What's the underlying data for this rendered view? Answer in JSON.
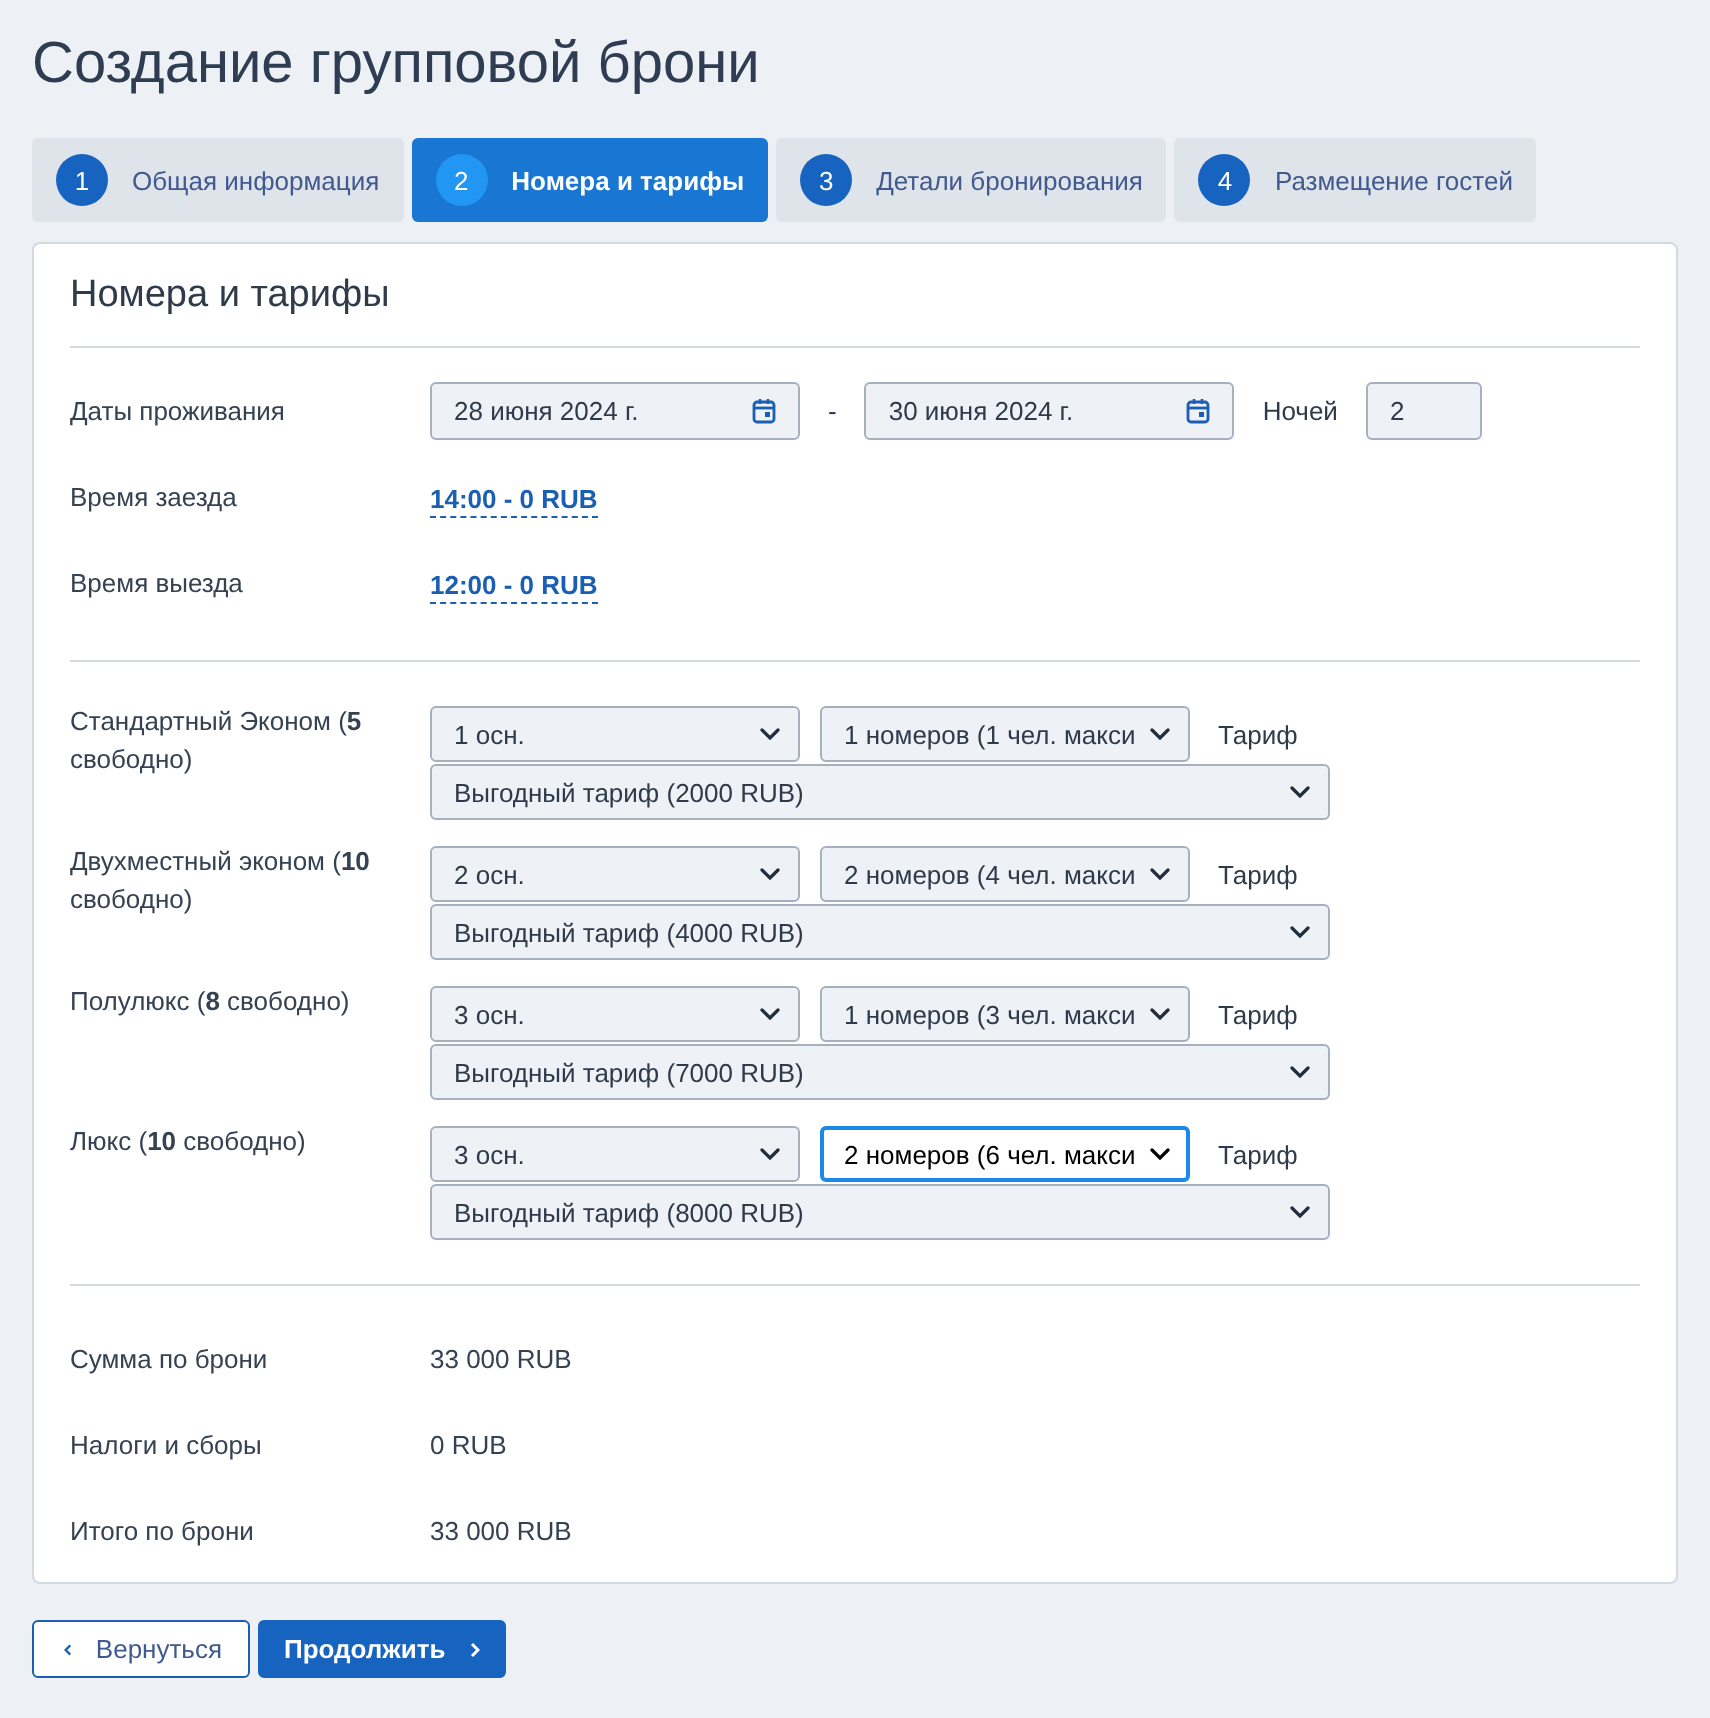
{
  "page": {
    "title": "Создание групповой брони"
  },
  "steps": [
    {
      "number": "1",
      "label": "Общая информация",
      "selected": false
    },
    {
      "number": "2",
      "label": "Номера и тарифы",
      "selected": true
    },
    {
      "number": "3",
      "label": "Детали бронирования",
      "selected": false
    },
    {
      "number": "4",
      "label": "Размещение гостей",
      "selected": false
    }
  ],
  "section": {
    "title": "Номера и тарифы"
  },
  "stay": {
    "dates_label": "Даты проживания",
    "date_from": "28 июня 2024 г.",
    "separator": "-",
    "date_to": "30 июня 2024 г.",
    "nights_label": "Ночей",
    "nights": "2",
    "checkin_label": "Время заезда",
    "checkin": "14:00 - 0 RUB",
    "checkout_label": "Время выезда",
    "checkout": "12:00 - 0 RUB"
  },
  "room_types": [
    {
      "label": "Стандартный Эконом (**5** свободно)",
      "guests": {
        "value": "1 осн.",
        "focused": false
      },
      "rooms": {
        "value": "1 номеров (1 чел. макси",
        "focused": false
      },
      "tariff_label": "Тариф",
      "tariff": {
        "value": "Выгодный тариф (2000 RUB)",
        "focused": false
      }
    },
    {
      "label": "Двухместный эконом (**10** свободно)",
      "guests": {
        "value": "2 осн.",
        "focused": false
      },
      "rooms": {
        "value": "2 номеров (4 чел. макси",
        "focused": false
      },
      "tariff_label": "Тариф",
      "tariff": {
        "value": "Выгодный тариф (4000 RUB)",
        "focused": false
      }
    },
    {
      "label": "Полулюкс (**8** свободно)",
      "guests": {
        "value": "3 осн.",
        "focused": false
      },
      "rooms": {
        "value": "1 номеров (3 чел. макси",
        "focused": false
      },
      "tariff_label": "Тариф",
      "tariff": {
        "value": "Выгодный тариф (7000 RUB)",
        "focused": false
      }
    },
    {
      "label": "Люкс (**10** свободно)",
      "guests": {
        "value": "3 осн.",
        "focused": false
      },
      "rooms": {
        "value": "2 номеров (6 чел. макси",
        "focused": true
      },
      "tariff_label": "Тариф",
      "tariff": {
        "value": "Выгодный тариф (8000 RUB)",
        "focused": false
      }
    }
  ],
  "summary": [
    {
      "label": "Сумма по брони",
      "value": "33 000 RUB"
    },
    {
      "label": "Налоги и сборы",
      "value": "0 RUB"
    },
    {
      "label": "Итого по брони",
      "value": "33 000 RUB"
    }
  ],
  "buttons": [
    {
      "kind": "back",
      "label": "Вернуться"
    },
    {
      "kind": "next",
      "label": "Продолжить"
    }
  ]
}
